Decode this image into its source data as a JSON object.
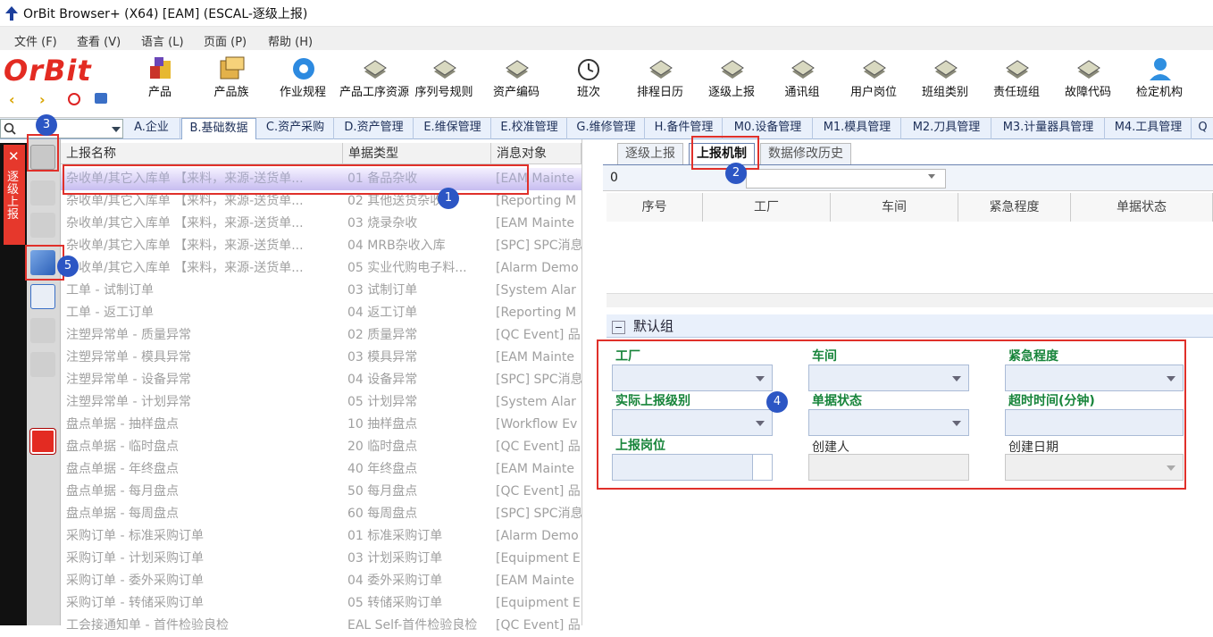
{
  "window": {
    "title": "OrBit Browser+ (X64) [EAM] (ESCAL-逐级上报)"
  },
  "menu": [
    "文件 (F)",
    "查看 (V)",
    "语言 (L)",
    "页面 (P)",
    "帮助 (H)"
  ],
  "logo": "OrBit",
  "toolbar": [
    {
      "label": "产品",
      "icon": "product-boxes-icon"
    },
    {
      "label": "产品族",
      "icon": "product-family-icon"
    },
    {
      "label": "作业规程",
      "icon": "gear-icon"
    },
    {
      "label": "产品工序资源",
      "icon": "toolkit-icon"
    },
    {
      "label": "序列号规则",
      "icon": "toolkit-icon"
    },
    {
      "label": "资产编码",
      "icon": "toolkit-icon"
    },
    {
      "label": "班次",
      "icon": "clock-icon"
    },
    {
      "label": "排程日历",
      "icon": "toolkit-icon"
    },
    {
      "label": "逐级上报",
      "icon": "toolkit-icon"
    },
    {
      "label": "通讯组",
      "icon": "toolkit-icon"
    },
    {
      "label": "用户岗位",
      "icon": "toolkit-icon"
    },
    {
      "label": "班组类别",
      "icon": "toolkit-icon"
    },
    {
      "label": "责任班组",
      "icon": "toolkit-icon"
    },
    {
      "label": "故障代码",
      "icon": "toolkit-icon"
    },
    {
      "label": "检定机构",
      "icon": "user-icon"
    }
  ],
  "module_tabs": [
    "A.企业",
    "B.基础数据",
    "C.资产采购",
    "D.资产管理",
    "E.维保管理",
    "E.校准管理",
    "G.维修管理",
    "H.备件管理",
    "M0.设备管理",
    "M1.模具管理",
    "M2.刀具管理",
    "M3.计量器具管理",
    "M4.工具管理",
    "Q"
  ],
  "sidebar_label": "逐级上报",
  "left_grid": {
    "headers": [
      "上报名称",
      "单据类型",
      "消息对象"
    ],
    "rows": [
      [
        "杂收单/其它入库单 【来料，来源-送货单...",
        "01 备品杂收",
        "[EAM Mainte"
      ],
      [
        "杂收单/其它入库单 【来料，来源-送货单...",
        "02 其他送货杂收",
        "[Reporting M"
      ],
      [
        "杂收单/其它入库单 【来料，来源-送货单...",
        "03 烧录杂收",
        "[EAM Mainte"
      ],
      [
        "杂收单/其它入库单 【来料，来源-送货单...",
        "04 MRB杂收入库",
        "[SPC] SPC消息"
      ],
      [
        "杂收单/其它入库单 【来料，来源-送货单...",
        "05 实业代购电子料...",
        "[Alarm Demo"
      ],
      [
        "工单 - 试制订单",
        "03 试制订单",
        "[System Alar"
      ],
      [
        "工单 - 返工订单",
        "04 返工订单",
        "[Reporting M"
      ],
      [
        "注塑异常单 - 质量异常",
        "02 质量异常",
        "[QC Event] 品"
      ],
      [
        "注塑异常单 - 模具异常",
        "03 模具异常",
        "[EAM Mainte"
      ],
      [
        "注塑异常单 - 设备异常",
        "04 设备异常",
        "[SPC] SPC消息"
      ],
      [
        "注塑异常单 - 计划异常",
        "05 计划异常",
        "[System Alar"
      ],
      [
        "盘点单据 - 抽样盘点",
        "10 抽样盘点",
        "[Workflow Ev"
      ],
      [
        "盘点单据 - 临时盘点",
        "20 临时盘点",
        "[QC Event] 品"
      ],
      [
        "盘点单据 - 年终盘点",
        "40 年终盘点",
        "[EAM Mainte"
      ],
      [
        "盘点单据 - 每月盘点",
        "50 每月盘点",
        "[QC Event] 品"
      ],
      [
        "盘点单据 - 每周盘点",
        "60 每周盘点",
        "[SPC] SPC消息"
      ],
      [
        "采购订单 - 标准采购订单",
        "01 标准采购订单",
        "[Alarm Demo"
      ],
      [
        "采购订单 - 计划采购订单",
        "03 计划采购订单",
        "[Equipment Er"
      ],
      [
        "采购订单 - 委外采购订单",
        "04 委外采购订单",
        "[EAM Mainte"
      ],
      [
        "采购订单 - 转储采购订单",
        "05 转储采购订单",
        "[Equipment Er"
      ],
      [
        "工会接通知单 - 首件检验良检",
        "EAL Self-首件检验良检",
        "[QC Event] 品"
      ]
    ]
  },
  "right_tabs": [
    "逐级上报",
    "上报机制",
    "数据修改历史"
  ],
  "nav_count": "0",
  "right_grid_headers": [
    "序号",
    "工厂",
    "车间",
    "紧急程度",
    "单据状态"
  ],
  "group_title": "默认组",
  "form": {
    "factory": "工厂",
    "workshop": "车间",
    "urgency": "紧急程度",
    "report_level": "实际上报级别",
    "doc_status": "单据状态",
    "timeout": "超时时间(分钟)",
    "post": "上报岗位",
    "creator": "创建人",
    "create_date": "创建日期"
  },
  "badges": [
    "1",
    "2",
    "3",
    "4",
    "5"
  ]
}
